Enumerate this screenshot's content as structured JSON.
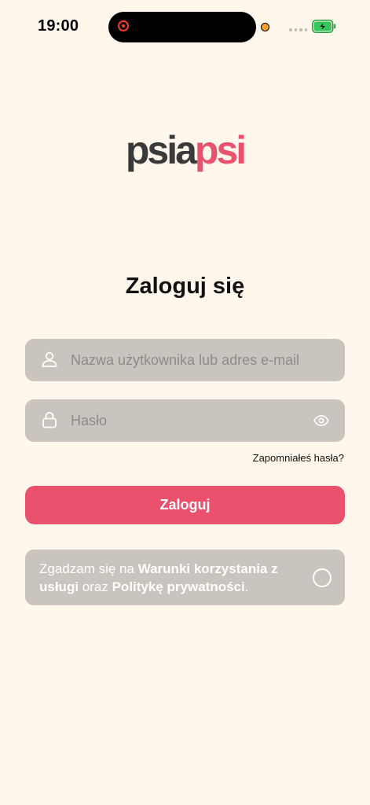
{
  "status_bar": {
    "time": "19:00"
  },
  "logo": {
    "part1": "psia",
    "part2": "psi"
  },
  "title": "Zaloguj się",
  "form": {
    "username_placeholder": "Nazwa użytkownika lub adres e-mail",
    "password_placeholder": "Hasło",
    "forgot_password": "Zapomniałeś hasła?",
    "login_button": "Zaloguj"
  },
  "terms": {
    "prefix": "Zgadzam się na ",
    "terms_link": "Warunki korzystania z usługi",
    "middle": " oraz ",
    "privacy_link": "Politykę prywatności",
    "suffix": "."
  },
  "colors": {
    "background": "#FFF7EC",
    "accent": "#EA516D",
    "field_bg": "#CAC4BE",
    "logo_dark": "#3B3A3A"
  }
}
